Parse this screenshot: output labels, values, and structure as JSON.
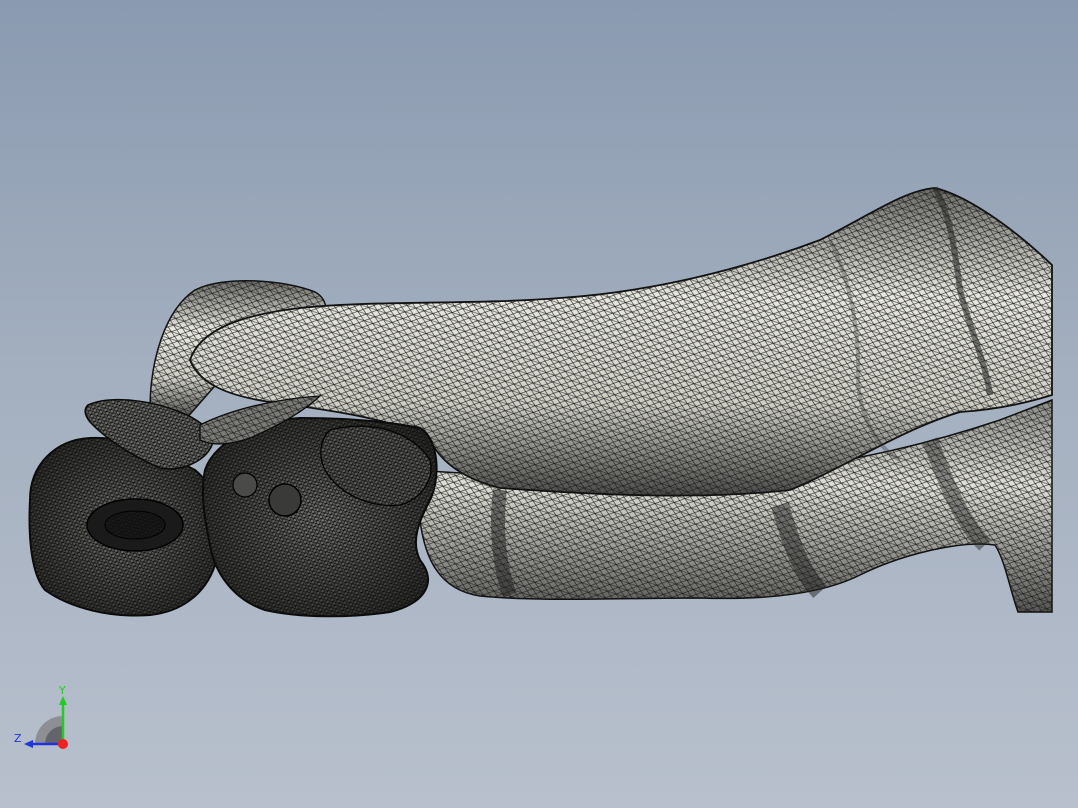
{
  "viewport": {
    "background_top": "#8a9ab0",
    "background_bottom": "#b8c0cd",
    "display_style": "shaded-with-mesh-edges"
  },
  "model": {
    "fill_light": "#e4e4dc",
    "fill_dark": "#5a5a58",
    "edge_color": "#111111"
  },
  "triad": {
    "y_label": "Y",
    "z_label": "Z",
    "y_color": "#22cc22",
    "z_color": "#2233dd",
    "x_color": "#ee2222"
  }
}
